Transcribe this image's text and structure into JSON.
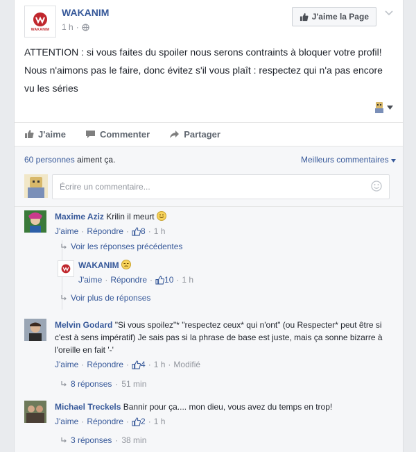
{
  "page": {
    "name": "WAKANIM",
    "logo_text": "WAKANIM",
    "time": "1 h",
    "separator": "·",
    "like_page_label": "J'aime la Page"
  },
  "post": {
    "text": "ATTENTION : si vous faites du spoiler nous serons contraints à bloquer votre profil! Nous n'aimons pas le faire, donc évitez s'il vous plaît : respectez qui n'a pas encore vu les séries"
  },
  "actions": {
    "like": "J'aime",
    "comment": "Commenter",
    "share": "Partager"
  },
  "summary": {
    "likes_link": "60 personnes",
    "likes_suffix": " aiment ça.",
    "sort_label": "Meilleurs commentaires"
  },
  "composer": {
    "placeholder": "Écrire un commentaire..."
  },
  "comments": [
    {
      "author": "Maxime Aziz",
      "text": "Krilin il meurt",
      "like": "J'aime",
      "reply": "Répondre",
      "count": "8",
      "time": "1 h",
      "replies": {
        "previous_link": "Voir les réponses précédentes",
        "reply_author": "WAKANIM",
        "reply_like": "J'aime",
        "reply_reply": "Répondre",
        "reply_count": "10",
        "reply_time": "1 h",
        "more_link": "Voir plus de réponses"
      }
    },
    {
      "author": "Melvin Godard",
      "text": "\"Si vous spoilez\"* \"respectez ceux* qui n'ont\" (ou Respecter* peut être si c'est à sens impératif) Je sais pas si la phrase de base est juste, mais ça sonne bizarre à l'oreille en fait '-'",
      "like": "J'aime",
      "reply": "Répondre",
      "count": "4",
      "time": "1 h",
      "edited": "Modifié",
      "replies_count": "8 réponses",
      "replies_time": "51 min"
    },
    {
      "author": "Michael Treckels",
      "text": "Bannir pour ça.... mon dieu, vous avez du temps en trop!",
      "like": "J'aime",
      "reply": "Répondre",
      "count": "2",
      "time": "1 h",
      "replies_count": "3 réponses",
      "replies_time": "38 min"
    }
  ],
  "colors": {
    "link": "#365899",
    "muted": "#90949c",
    "brand": "#c0272d"
  },
  "icons": [
    "wakanim-logo-icon",
    "globe-icon",
    "thumb-up-icon",
    "comment-icon",
    "share-icon",
    "chevron-down-icon",
    "emoji-icon",
    "reply-arrow-icon"
  ]
}
